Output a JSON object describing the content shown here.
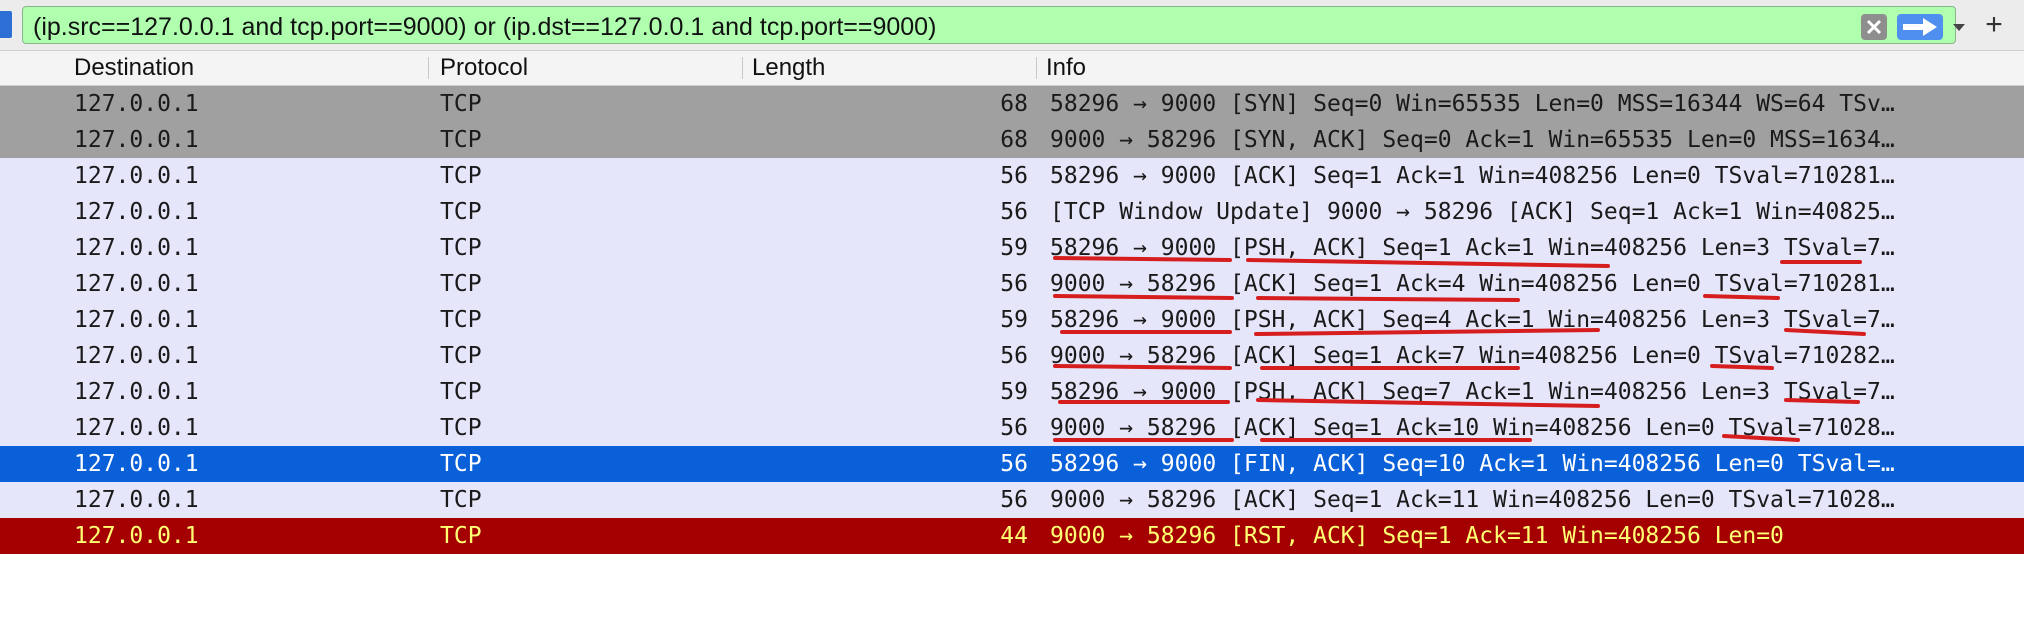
{
  "filter": {
    "expression": "(ip.src==127.0.0.1 and tcp.port==9000) or (ip.dst==127.0.0.1 and tcp.port==9000)",
    "add_label": "+"
  },
  "columns": {
    "destination": "Destination",
    "protocol": "Protocol",
    "length": "Length",
    "info": "Info"
  },
  "packets": [
    {
      "dst": "127.0.0.1",
      "proto": "TCP",
      "len": "68",
      "info": "58296 → 9000 [SYN] Seq=0 Win=65535 Len=0 MSS=16344 WS=64 TSv…",
      "style": "syn"
    },
    {
      "dst": "127.0.0.1",
      "proto": "TCP",
      "len": "68",
      "info": "9000 → 58296 [SYN, ACK] Seq=0 Ack=1 Win=65535 Len=0 MSS=1634…",
      "style": "syn"
    },
    {
      "dst": "127.0.0.1",
      "proto": "TCP",
      "len": "56",
      "info": "58296 → 9000 [ACK] Seq=1 Ack=1 Win=408256 Len=0 TSval=710281…",
      "style": "normal"
    },
    {
      "dst": "127.0.0.1",
      "proto": "TCP",
      "len": "56",
      "info": "[TCP Window Update] 9000 → 58296 [ACK] Seq=1 Ack=1 Win=40825…",
      "style": "normal"
    },
    {
      "dst": "127.0.0.1",
      "proto": "TCP",
      "len": "59",
      "info": "58296 → 9000 [PSH, ACK] Seq=1 Ack=1 Win=408256 Len=3 TSval=7…",
      "style": "normal"
    },
    {
      "dst": "127.0.0.1",
      "proto": "TCP",
      "len": "56",
      "info": "9000 → 58296 [ACK] Seq=1 Ack=4 Win=408256 Len=0 TSval=710281…",
      "style": "normal"
    },
    {
      "dst": "127.0.0.1",
      "proto": "TCP",
      "len": "59",
      "info": "58296 → 9000 [PSH, ACK] Seq=4 Ack=1 Win=408256 Len=3 TSval=7…",
      "style": "normal"
    },
    {
      "dst": "127.0.0.1",
      "proto": "TCP",
      "len": "56",
      "info": "9000 → 58296 [ACK] Seq=1 Ack=7 Win=408256 Len=0 TSval=710282…",
      "style": "normal"
    },
    {
      "dst": "127.0.0.1",
      "proto": "TCP",
      "len": "59",
      "info": "58296 → 9000 [PSH, ACK] Seq=7 Ack=1 Win=408256 Len=3 TSval=7…",
      "style": "normal"
    },
    {
      "dst": "127.0.0.1",
      "proto": "TCP",
      "len": "56",
      "info": "9000 → 58296 [ACK] Seq=1 Ack=10 Win=408256 Len=0 TSval=71028…",
      "style": "normal"
    },
    {
      "dst": "127.0.0.1",
      "proto": "TCP",
      "len": "56",
      "info": "58296 → 9000 [FIN, ACK] Seq=10 Ack=1 Win=408256 Len=0 TSval=…",
      "style": "selected"
    },
    {
      "dst": "127.0.0.1",
      "proto": "TCP",
      "len": "56",
      "info": "9000 → 58296 [ACK] Seq=1 Ack=11 Win=408256 Len=0 TSval=71028…",
      "style": "normal"
    },
    {
      "dst": "127.0.0.1",
      "proto": "TCP",
      "len": "44",
      "info": "9000 → 58296 [RST, ACK] Seq=1 Ack=11 Win=408256 Len=0",
      "style": "rst"
    }
  ],
  "icons": {
    "bookmark": "bookmark-icon",
    "clear": "clear-filter-icon",
    "apply": "apply-arrow-icon",
    "dropdown": "chevron-down-icon",
    "add": "plus-icon"
  },
  "colors": {
    "filter_valid": "#afffaf",
    "row_syn": "#a0a0a0",
    "row_normal": "#e6e6fb",
    "row_selected": "#0a60d8",
    "row_rst": "#a40000",
    "rst_text": "#ffff73",
    "annotation": "#d61e1e"
  }
}
